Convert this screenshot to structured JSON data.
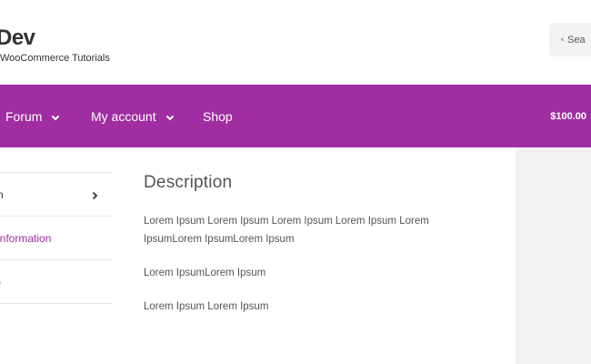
{
  "header": {
    "site_title": "Dev",
    "tagline": "WooCommerce Tutorials",
    "search_placeholder": "Sea"
  },
  "nav": {
    "items": [
      {
        "label": "Forum",
        "has_dropdown": true
      },
      {
        "label": "My account",
        "has_dropdown": true
      },
      {
        "label": "Shop",
        "has_dropdown": false
      }
    ],
    "cart_total": "$100.00",
    "background_color": "#a02ea2"
  },
  "tabs": [
    {
      "label": "n",
      "active": false
    },
    {
      "label": "information",
      "active": true
    },
    {
      "label": ")",
      "active": false
    }
  ],
  "description": {
    "title": "Description",
    "paragraphs": [
      "Lorem Ipsum Lorem Ipsum Lorem Ipsum Lorem Ipsum Lorem IpsumLorem IpsumLorem Ipsum",
      "Lorem IpsumLorem Ipsum",
      "Lorem Ipsum Lorem Ipsum"
    ]
  },
  "colors": {
    "accent": "#a02ea2",
    "active_tab_text": "#9b2f9d",
    "sidebar_bg": "#f2f2f2"
  }
}
